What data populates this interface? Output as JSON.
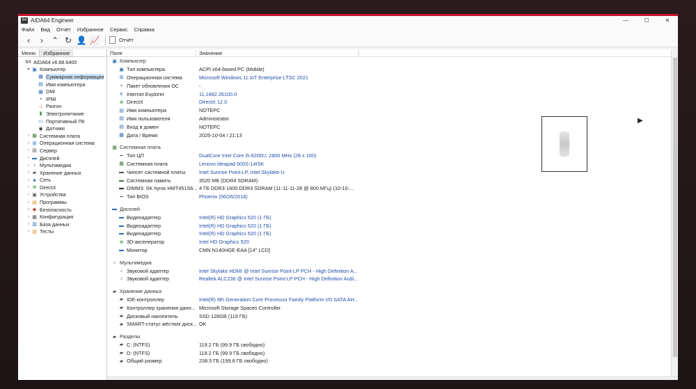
{
  "window": {
    "app_badge": "64",
    "title": "AIDA64 Engineer",
    "minimize": "—",
    "maximize": "☐",
    "close": "✕"
  },
  "menu": [
    "Файл",
    "Вид",
    "Отчёт",
    "Избранное",
    "Сервис",
    "Справка"
  ],
  "toolbar": {
    "report_label": "Отчёт"
  },
  "left": {
    "tabs": [
      "Меню",
      "Избранное"
    ],
    "tree": [
      {
        "label": "AIDA64 v6.88.6400",
        "indent": 0,
        "exp": "",
        "icon": "aida-icon",
        "glyph": "64",
        "color": "#333"
      },
      {
        "label": "Компьютер",
        "indent": 1,
        "exp": "▾",
        "icon": "computer-icon",
        "glyph": "▣",
        "color": "#2d6db5"
      },
      {
        "label": "Суммарная информация",
        "indent": 2,
        "exp": "",
        "icon": "summary-icon",
        "glyph": "▦",
        "color": "#2d6db5",
        "selected": true
      },
      {
        "label": "Имя компьютера",
        "indent": 2,
        "exp": "",
        "icon": "computer-name-icon",
        "glyph": "▤",
        "color": "#2d6db5"
      },
      {
        "label": "DMI",
        "indent": 2,
        "exp": "",
        "icon": "dmi-icon",
        "glyph": "▦",
        "color": "#2d6db5"
      },
      {
        "label": "IPMI",
        "indent": 2,
        "exp": "",
        "icon": "ipmi-icon",
        "glyph": "▪",
        "color": "#555"
      },
      {
        "label": "Разгон",
        "indent": 2,
        "exp": "",
        "icon": "overclock-icon",
        "glyph": "♨",
        "color": "#d9531e"
      },
      {
        "label": "Электропитание",
        "indent": 2,
        "exp": "",
        "icon": "power-icon",
        "glyph": "▮",
        "color": "#3a9a3a"
      },
      {
        "label": "Портативный ПК",
        "indent": 2,
        "exp": "",
        "icon": "laptop-icon",
        "glyph": "▭",
        "color": "#2d6db5"
      },
      {
        "label": "Датчики",
        "indent": 2,
        "exp": "",
        "icon": "sensor-icon",
        "glyph": "◉",
        "color": "#333"
      },
      {
        "label": "Системная плата",
        "indent": 1,
        "exp": "›",
        "icon": "motherboard-icon",
        "glyph": "▦",
        "color": "#3a7a3a"
      },
      {
        "label": "Операционная система",
        "indent": 1,
        "exp": "›",
        "icon": "os-icon",
        "glyph": "⊞",
        "color": "#1f6fd0"
      },
      {
        "label": "Сервер",
        "indent": 1,
        "exp": "›",
        "icon": "server-icon",
        "glyph": "▥",
        "color": "#555"
      },
      {
        "label": "Дисплей",
        "indent": 1,
        "exp": "›",
        "icon": "display-icon",
        "glyph": "▬",
        "color": "#2d6db5"
      },
      {
        "label": "Мультимедиа",
        "indent": 1,
        "exp": "›",
        "icon": "multimedia-icon",
        "glyph": "♪",
        "color": "#555"
      },
      {
        "label": "Хранение данных",
        "indent": 1,
        "exp": "›",
        "icon": "storage-icon",
        "glyph": "▰",
        "color": "#555"
      },
      {
        "label": "Сеть",
        "indent": 1,
        "exp": "›",
        "icon": "network-icon",
        "glyph": "◈",
        "color": "#2d6db5"
      },
      {
        "label": "DirectX",
        "indent": 1,
        "exp": "›",
        "icon": "directx-icon",
        "glyph": "⊗",
        "color": "#2f8f2f"
      },
      {
        "label": "Устройства",
        "indent": 1,
        "exp": "›",
        "icon": "devices-icon",
        "glyph": "▣",
        "color": "#555"
      },
      {
        "label": "Программы",
        "indent": 1,
        "exp": "›",
        "icon": "programs-icon",
        "glyph": "▤",
        "color": "#d28a1e"
      },
      {
        "label": "Безопасность",
        "indent": 1,
        "exp": "›",
        "icon": "security-icon",
        "glyph": "◆",
        "color": "#c0392b"
      },
      {
        "label": "Конфигурация",
        "indent": 1,
        "exp": "›",
        "icon": "config-icon",
        "glyph": "▦",
        "color": "#555"
      },
      {
        "label": "База данных",
        "indent": 1,
        "exp": "›",
        "icon": "database-icon",
        "glyph": "▥",
        "color": "#2d6db5"
      },
      {
        "label": "Тесты",
        "indent": 1,
        "exp": "›",
        "icon": "tests-icon",
        "glyph": "▤",
        "color": "#d28a1e"
      }
    ]
  },
  "columns": {
    "field": "Поле",
    "value": "Значение"
  },
  "rows": [
    {
      "type": "section",
      "field": "Компьютер",
      "icon": "computer-icon",
      "glyph": "▣",
      "color": "#2d6db5"
    },
    {
      "field": "Тип компьютера",
      "value": "ACPI x64-based PC  (Mobile)",
      "icon": "computer-type-icon",
      "glyph": "▣",
      "color": "#2d6db5"
    },
    {
      "field": "Операционная система",
      "value": "Microsoft Windows 11 IoT Enterprise LTSC 2021",
      "link": true,
      "icon": "os-icon",
      "glyph": "⊞",
      "color": "#1f6fd0"
    },
    {
      "field": "Пакет обновления ОС",
      "value": "-",
      "icon": "os-update-icon",
      "glyph": "▪",
      "color": "#555"
    },
    {
      "field": "Internet Explorer",
      "value": "11.1882.26100.0",
      "link": true,
      "icon": "ie-icon",
      "glyph": "e",
      "color": "#1f6fd0"
    },
    {
      "field": "DirectX",
      "value": "DirectX 12.0",
      "link": true,
      "icon": "directx-icon",
      "glyph": "⊗",
      "color": "#2f8f2f"
    },
    {
      "field": "Имя компьютера",
      "value": "NOTEPC",
      "icon": "computer-name-icon",
      "glyph": "▤",
      "color": "#2d6db5"
    },
    {
      "field": "Имя пользователя",
      "value": "Administrator",
      "icon": "user-icon",
      "glyph": "▤",
      "color": "#2d6db5"
    },
    {
      "field": "Вход в домен",
      "value": "NOTEPC",
      "icon": "domain-icon",
      "glyph": "▤",
      "color": "#2d6db5"
    },
    {
      "field": "Дата / Время",
      "value": "2025-10-04 / 21:13",
      "icon": "calendar-icon",
      "glyph": "▦",
      "color": "#2d6db5"
    },
    {
      "type": "gap"
    },
    {
      "type": "section",
      "field": "Системная плата",
      "icon": "motherboard-icon",
      "glyph": "▦",
      "color": "#3a7a3a"
    },
    {
      "field": "Тип ЦП",
      "value": "DualCore Intel Core i5-6200U, 2800 MHz (28 x 100)",
      "link": true,
      "icon": "cpu-icon",
      "glyph": "━",
      "color": "#555"
    },
    {
      "field": "Системная плата",
      "value": "Lenovo ideapad 500S-14ISK",
      "link": true,
      "icon": "motherboard-icon",
      "glyph": "▦",
      "color": "#3a7a3a"
    },
    {
      "field": "Чипсет системной платы",
      "value": "Intel Sunrise Point-LP, Intel Skylake-U",
      "link": true,
      "icon": "chipset-icon",
      "glyph": "▬",
      "color": "#555"
    },
    {
      "field": "Системная память",
      "value": "3520 МБ  (DDR4 SDRAM)",
      "icon": "memory-icon",
      "glyph": "▬",
      "color": "#3a7a3a"
    },
    {
      "field": "DIMM3: SK hynix HMT451S6...",
      "value": "4 ГБ DDR3-1600 DDR3 SDRAM  (11-11-11-28 @ 800 МГц)  (10-10-...",
      "icon": "dimm-icon",
      "glyph": "▬",
      "color": "#333"
    },
    {
      "field": "Тип BIOS",
      "value": "Phoenix (06/26/2018)",
      "link": true,
      "icon": "bios-icon",
      "glyph": "━",
      "color": "#555"
    },
    {
      "type": "gap"
    },
    {
      "type": "section",
      "field": "Дисплей",
      "icon": "display-icon",
      "glyph": "▬",
      "color": "#2d6db5"
    },
    {
      "field": "Видеоадаптер",
      "value": "Intel(R) HD Graphics 520  (1 ГБ)",
      "link": true,
      "icon": "gpu-icon",
      "glyph": "▬",
      "color": "#2d6db5"
    },
    {
      "field": "Видеоадаптер",
      "value": "Intel(R) HD Graphics 520  (1 ГБ)",
      "link": true,
      "icon": "gpu-icon",
      "glyph": "▬",
      "color": "#2d6db5"
    },
    {
      "field": "Видеоадаптер",
      "value": "Intel(R) HD Graphics 520  (1 ГБ)",
      "link": true,
      "icon": "gpu-icon",
      "glyph": "▬",
      "color": "#2d6db5"
    },
    {
      "field": "3D-акселератор",
      "value": "Intel HD Graphics 520",
      "link": true,
      "icon": "3d-icon",
      "glyph": "⊗",
      "color": "#2f8f2f"
    },
    {
      "field": "Монитор",
      "value": "CMN N140HGE-EAA  [14\" LCD]",
      "icon": "monitor-icon",
      "glyph": "▬",
      "color": "#2d6db5"
    },
    {
      "type": "gap"
    },
    {
      "type": "section",
      "field": "Мультимедиа",
      "icon": "multimedia-icon",
      "glyph": "♪",
      "color": "#555"
    },
    {
      "field": "Звуковой адаптер",
      "value": "Intel Skylake HDMI @ Intel Sunrise Point-LP PCH - High Definition A...",
      "link": true,
      "icon": "audio-icon",
      "glyph": "♪",
      "color": "#555"
    },
    {
      "field": "Звуковой адаптер",
      "value": "Realtek ALC236 @ Intel Sunrise Point-LP PCH - High Definition Audi...",
      "link": true,
      "icon": "audio-icon",
      "glyph": "♪",
      "color": "#555"
    },
    {
      "type": "gap"
    },
    {
      "type": "section",
      "field": "Хранение данных",
      "icon": "storage-icon",
      "glyph": "▰",
      "color": "#555"
    },
    {
      "field": "IDE-контроллер",
      "value": "Intel(R) 6th Generation Core Processor Family Platform I/O SATA AH...",
      "link": true,
      "icon": "ide-icon",
      "glyph": "▰",
      "color": "#555"
    },
    {
      "field": "Контроллер хранения данн...",
      "value": "Microsoft Storage Spaces Controller",
      "icon": "storage-controller-icon",
      "glyph": "▰",
      "color": "#555"
    },
    {
      "field": "Дисковый накопитель",
      "value": "SSD 128GB  (119 ГБ)",
      "icon": "disk-icon",
      "glyph": "▰",
      "color": "#555"
    },
    {
      "field": "SMART-статус жёстких диск...",
      "value": "OK",
      "icon": "smart-icon",
      "glyph": "▰",
      "color": "#555"
    },
    {
      "type": "gap"
    },
    {
      "type": "section",
      "field": "Разделы",
      "icon": "partition-icon",
      "glyph": "▰",
      "color": "#555"
    },
    {
      "field": "C: (NTFS)",
      "value": "119.2 ГБ (99.9 ГБ свободно)",
      "icon": "partition-icon",
      "glyph": "▰",
      "color": "#555"
    },
    {
      "field": "D: (NTFS)",
      "value": "119.2 ГБ (99.9 ГБ свободно)",
      "icon": "partition-icon",
      "glyph": "▰",
      "color": "#555"
    },
    {
      "field": "Общий размер",
      "value": "238.5 ГБ (199.8 ГБ свободно)",
      "icon": "partition-icon",
      "glyph": "▰",
      "color": "#555"
    }
  ]
}
